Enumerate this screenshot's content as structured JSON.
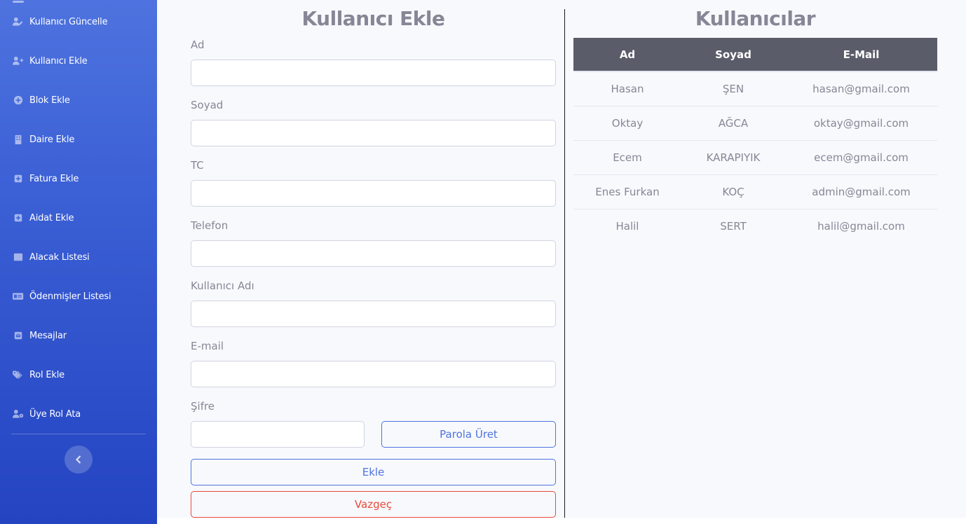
{
  "sidebar": {
    "items": [
      {
        "label": "Kullanıcı Güncelle",
        "icon": "user-edit-icon"
      },
      {
        "label": "Kullanıcı Ekle",
        "icon": "user-plus-icon"
      },
      {
        "label": "Blok Ekle",
        "icon": "plus-circle-icon"
      },
      {
        "label": "Daire Ekle",
        "icon": "building-icon"
      },
      {
        "label": "Fatura Ekle",
        "icon": "plus-square-icon"
      },
      {
        "label": "Aidat Ekle",
        "icon": "plus-square-icon"
      },
      {
        "label": "Alacak Listesi",
        "icon": "table-icon"
      },
      {
        "label": "Ödenmişler Listesi",
        "icon": "id-card-icon"
      },
      {
        "label": "Mesajlar",
        "icon": "envelope-square-icon"
      },
      {
        "label": "Rol Ekle",
        "icon": "tags-icon"
      },
      {
        "label": "Üye Rol Ata",
        "icon": "user-cog-icon"
      }
    ],
    "toggle_icon": "chevron-left-icon"
  },
  "form": {
    "title": "Kullanıcı Ekle",
    "fields": [
      {
        "label": "Ad",
        "value": "",
        "placeholder": ""
      },
      {
        "label": "Soyad",
        "value": "",
        "placeholder": ""
      },
      {
        "label": "TC",
        "value": "",
        "placeholder": ""
      },
      {
        "label": "Telefon",
        "value": "",
        "placeholder": ""
      },
      {
        "label": "Kullanıcı Adı",
        "value": "",
        "placeholder": ""
      },
      {
        "label": "E-mail",
        "value": "",
        "placeholder": ""
      }
    ],
    "password": {
      "label": "Şifre",
      "value": "",
      "placeholder": ""
    },
    "generate_label": "Parola Üret",
    "submit_label": "Ekle",
    "cancel_label": "Vazgeç"
  },
  "users": {
    "title": "Kullanıcılar",
    "columns": [
      "Ad",
      "Soyad",
      "E-Mail"
    ],
    "rows": [
      [
        "Hasan",
        "ŞEN",
        "hasan@gmail.com"
      ],
      [
        "Oktay",
        "AĞCA",
        "oktay@gmail.com"
      ],
      [
        "Ecem",
        "KARAPIYIK",
        "ecem@gmail.com"
      ],
      [
        "Enes Furkan",
        "KOÇ",
        "admin@gmail.com"
      ],
      [
        "Halil",
        "SERT",
        "halil@gmail.com"
      ]
    ]
  },
  "colors": {
    "sidebar_top": "#4e73df",
    "sidebar_bottom": "#2444c2",
    "primary": "#4e73df",
    "danger": "#e74a3b",
    "table_header": "#5a5c69"
  }
}
